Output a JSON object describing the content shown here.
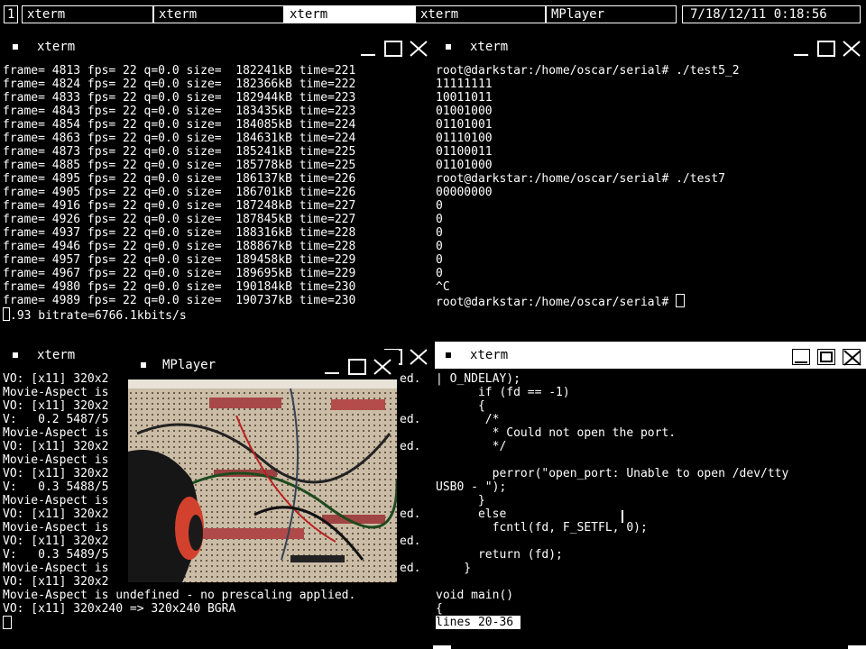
{
  "taskbar": {
    "workspace": "1",
    "tasks": [
      "xterm",
      "xterm",
      "xterm",
      "xterm",
      "MPlayer"
    ],
    "active_index": 2,
    "clock": "7/18/12/11  0:18:56"
  },
  "win_top_left": {
    "title": "xterm",
    "lines": [
      "frame= 4813 fps= 22 q=0.0 size=  182241kB time=221",
      "frame= 4824 fps= 22 q=0.0 size=  182366kB time=222",
      "frame= 4833 fps= 22 q=0.0 size=  182944kB time=223",
      "frame= 4843 fps= 22 q=0.0 size=  183435kB time=223",
      "frame= 4854 fps= 22 q=0.0 size=  184085kB time=224",
      "frame= 4863 fps= 22 q=0.0 size=  184631kB time=224",
      "frame= 4873 fps= 22 q=0.0 size=  185241kB time=225",
      "frame= 4885 fps= 22 q=0.0 size=  185778kB time=225",
      "frame= 4895 fps= 22 q=0.0 size=  186137kB time=226",
      "frame= 4905 fps= 22 q=0.0 size=  186701kB time=226",
      "frame= 4916 fps= 22 q=0.0 size=  187248kB time=227",
      "frame= 4926 fps= 22 q=0.0 size=  187845kB time=227",
      "frame= 4937 fps= 22 q=0.0 size=  188316kB time=228",
      "frame= 4946 fps= 22 q=0.0 size=  188867kB time=228",
      "frame= 4957 fps= 22 q=0.0 size=  189458kB time=229",
      "frame= 4967 fps= 22 q=0.0 size=  189695kB time=229",
      "frame= 4980 fps= 22 q=0.0 size=  190184kB time=230",
      "frame= 4989 fps= 22 q=0.0 size=  190737kB time=230"
    ],
    "last_line": ".93 bitrate=6766.1kbits/s"
  },
  "win_top_right": {
    "title": "xterm",
    "lines": [
      "root@darkstar:/home/oscar/serial# ./test5_2",
      "11111111",
      "10011011",
      "01001000",
      "01101001",
      "01110100",
      "01100011",
      "01101000",
      "root@darkstar:/home/oscar/serial# ./test7",
      "00000000",
      "0",
      "0",
      "0",
      "0",
      "0",
      "0",
      "^C"
    ],
    "prompt": "root@darkstar:/home/oscar/serial# "
  },
  "win_bottom_left": {
    "title": "xterm",
    "lines": [
      "VO: [x11] 320x2",
      "Movie-Aspect is",
      "VO: [x11] 320x2",
      "V:   0.2 5487/5",
      "Movie-Aspect is",
      "VO: [x11] 320x2",
      "Movie-Aspect is",
      "VO: [x11] 320x2",
      "V:   0.3 5488/5",
      "Movie-Aspect is",
      "VO: [x11] 320x2",
      "Movie-Aspect is",
      "VO: [x11] 320x2",
      "V:   0.3 5489/5",
      "Movie-Aspect is",
      "VO: [x11] 320x2"
    ],
    "right_fragments": [
      "ed.",
      "",
      "",
      "ed.",
      "",
      "ed.",
      "",
      "",
      "",
      "",
      "ed.",
      "",
      "ed.",
      "",
      "ed.",
      ""
    ],
    "line_full_1": "Movie-Aspect is undefined - no prescaling applied.",
    "line_full_2": "VO: [x11] 320x240 => 320x240 BGRA"
  },
  "mplayer": {
    "title": "MPlayer"
  },
  "win_bottom_right": {
    "title": "xterm",
    "lines": [
      "| O_NDELAY);",
      "      if (fd == -1)",
      "      {",
      "       /*",
      "        * Could not open the port.",
      "        */",
      "",
      "        perror(\"open_port: Unable to open /dev/tty",
      "USB0 - \");",
      "      }",
      "      else",
      "        fcntl(fd, F_SETFL, 0);",
      "",
      "      return (fd);",
      "    }",
      "",
      "void main()",
      "{"
    ],
    "status": "lines 20-36"
  }
}
